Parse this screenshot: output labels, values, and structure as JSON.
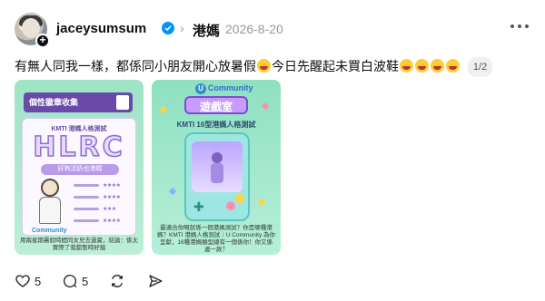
{
  "post": {
    "author": "jaceysumsum",
    "topic": "港媽",
    "date": "2026-8-20",
    "text_main": "有無人同我一樣，都係同小朋友開心放暑假",
    "text_cont": "今日先醒起未買白波鞋",
    "media_counter": "1/2"
  },
  "media": {
    "card1": {
      "banner": "個性徽章收集",
      "subtitle": "KMTI 港媽人格測試",
      "big_letters": "HLRC",
      "tag": "好狗活奶也港媽",
      "brand": "Community",
      "footer": "用兩星期暑假時間同女兒去過夏，結論：係太實際了我都暫時好搵"
    },
    "card2": {
      "brand": "Community",
      "title": "遊戲室",
      "subtitle": "KMTI 16型港媽人格測試",
      "footer": "最適合你嘅就係一個港媽測試？你是哪種港媽？KMTI 港媽人格測試｜U Community 為你呈獻，16種港媽類型總有一個係你！你又係邊一款？"
    }
  },
  "actions": {
    "likes": "5",
    "comments": "5"
  },
  "colors": {
    "verified": "#0095f6",
    "card_mint": "#9fe3c6",
    "purple": "#6a4aa8"
  },
  "icons": [
    "verified-icon",
    "chevron-right-icon",
    "more-icon",
    "heart-icon",
    "comment-icon",
    "repost-icon",
    "share-icon"
  ]
}
